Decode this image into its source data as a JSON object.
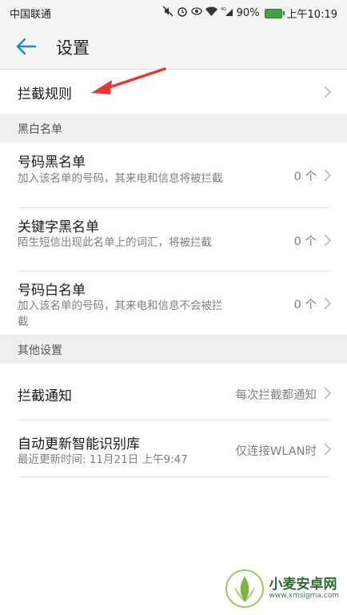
{
  "status_bar": {
    "carrier": "中国联通",
    "signal": "4G",
    "battery": "90%",
    "time": "上午10:19"
  },
  "app_bar": {
    "title": "设置"
  },
  "rules": {
    "label": "拦截规则"
  },
  "sections": {
    "blackwhite": "黑白名单",
    "other": "其他设置"
  },
  "blackwhite_items": {
    "number_blacklist": {
      "label": "号码黑名单",
      "desc": "加入该名单的号码，其来电和信息将被拦截",
      "value": "0 个"
    },
    "keyword_blacklist": {
      "label": "关键字黑名单",
      "desc": "陌生短信出现此名单上的词汇，将被拦截",
      "value": "0 个"
    },
    "number_whitelist": {
      "label": "号码白名单",
      "desc": "加入该名单的号码，其来电和信息不会被拦截",
      "value": "0 个"
    }
  },
  "other_items": {
    "block_notification": {
      "label": "拦截通知",
      "value": "每次拦截都通知"
    },
    "auto_update": {
      "label": "自动更新智能识别库",
      "desc": "最近更新时间: 11月21日 上午9:47",
      "value": "仅连接WLAN时"
    }
  },
  "watermark": {
    "text": "小麦安卓网",
    "url": "www.xmsigma.com"
  },
  "colors": {
    "accent": "#1e88e5",
    "annotation": "#e53935",
    "section_bg": "#f0f0f0"
  }
}
